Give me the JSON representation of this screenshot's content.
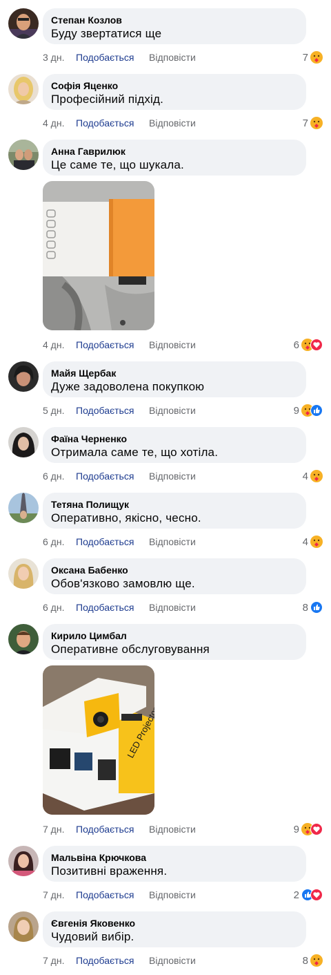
{
  "comments": [
    {
      "author": "Степан Козлов",
      "text": "Буду звертатися ще",
      "time": "3 дн.",
      "like_label": "Подобається",
      "reply_label": "Відповісти",
      "reaction_count": "7",
      "reactions": [
        "care"
      ]
    },
    {
      "author": "Софія Яценко",
      "text": "Професійний підхід.",
      "time": "4 дн.",
      "like_label": "Подобається",
      "reply_label": "Відповісти",
      "reaction_count": "7",
      "reactions": [
        "care"
      ]
    },
    {
      "author": "Анна Гаврилюк",
      "text": "Це саме те, що шукала.",
      "time": "4 дн.",
      "like_label": "Подобається",
      "reply_label": "Відповісти",
      "reaction_count": "6",
      "reactions": [
        "care",
        "love"
      ],
      "photo": "projector-closeup-photo"
    },
    {
      "author": "Майя Щербак",
      "text": "Дуже задоволена покупкою",
      "time": "5 дн.",
      "like_label": "Подобається",
      "reply_label": "Відповісти",
      "reaction_count": "9",
      "reactions": [
        "care",
        "like"
      ]
    },
    {
      "author": "Фаїна Черненко",
      "text": "Отримала саме те, що хотіла.",
      "time": "6 дн.",
      "like_label": "Подобається",
      "reply_label": "Відповісти",
      "reaction_count": "4",
      "reactions": [
        "care"
      ]
    },
    {
      "author": "Тетяна Полищук",
      "text": "Оперативно, якісно, чесно.",
      "time": "6 дн.",
      "like_label": "Подобається",
      "reply_label": "Відповісти",
      "reaction_count": "4",
      "reactions": [
        "care"
      ]
    },
    {
      "author": "Оксана Бабенко",
      "text": "Обов'язково замовлю ще.",
      "time": "6 дн.",
      "like_label": "Подобається",
      "reply_label": "Відповісти",
      "reaction_count": "8",
      "reactions": [
        "like"
      ]
    },
    {
      "author": "Кирило Цимбал",
      "text": "Оперативне обслуговування",
      "time": "7 дн.",
      "like_label": "Подобається",
      "reply_label": "Відповісти",
      "reaction_count": "9",
      "reactions": [
        "care",
        "love"
      ],
      "photo": "projector-box-photo",
      "photo_text": "LED Projector"
    },
    {
      "author": "Мальвіна Крючкова",
      "text": "Позитивні враження.",
      "time": "7 дн.",
      "like_label": "Подобається",
      "reply_label": "Відповісти",
      "reaction_count": "2",
      "reactions": [
        "like",
        "love"
      ]
    },
    {
      "author": "Євгенія Яковенко",
      "text": "Чудовий вибір.",
      "time": "7 дн.",
      "like_label": "Подобається",
      "reply_label": "Відповісти",
      "reaction_count": "8",
      "reactions": [
        "care"
      ]
    }
  ],
  "colors": {
    "bubble": "#f0f2f5",
    "like_text": "#1d3b8f",
    "muted_text": "#65676b",
    "like_reaction": "#1877f2",
    "love_reaction": "#f02849",
    "care_reaction": "#f7b125"
  }
}
